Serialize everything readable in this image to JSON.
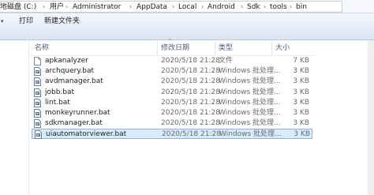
{
  "address": {
    "crumbs": [
      "地磁盘 (C:)",
      "用户",
      "Administrator",
      "AppData",
      "Local",
      "Android",
      "Sdk",
      "tools",
      "bin"
    ],
    "separator": "›"
  },
  "toolbar": {
    "organize_arrow": "▾",
    "print": "打印",
    "new_folder": "新建文件夹"
  },
  "columns": {
    "name": "名称",
    "date": "修改日期",
    "type": "类型",
    "size": "大小"
  },
  "files": [
    {
      "name": "apkanalyzer",
      "date": "2020/5/18 21:28",
      "type": "文件",
      "size": "7 KB",
      "icon": "file-icon"
    },
    {
      "name": "archquery.bat",
      "date": "2020/5/18 21:28",
      "type": "Windows 批处理...",
      "size": "3 KB",
      "icon": "batch-file-icon"
    },
    {
      "name": "avdmanager.bat",
      "date": "2020/5/18 21:28",
      "type": "Windows 批处理...",
      "size": "3 KB",
      "icon": "batch-file-icon"
    },
    {
      "name": "jobb.bat",
      "date": "2020/5/18 21:28",
      "type": "Windows 批处理...",
      "size": "3 KB",
      "icon": "batch-file-icon"
    },
    {
      "name": "lint.bat",
      "date": "2020/5/18 21:28",
      "type": "Windows 批处理...",
      "size": "3 KB",
      "icon": "batch-file-icon"
    },
    {
      "name": "monkeyrunner.bat",
      "date": "2020/5/18 21:28",
      "type": "Windows 批处理...",
      "size": "3 KB",
      "icon": "batch-file-icon"
    },
    {
      "name": "sdkmanager.bat",
      "date": "2020/5/18 21:28",
      "type": "Windows 批处理...",
      "size": "3 KB",
      "icon": "batch-file-icon"
    },
    {
      "name": "uiautomatorviewer.bat",
      "date": "2020/5/18 21:28",
      "type": "Windows 批处理...",
      "size": "3 KB",
      "icon": "batch-file-icon",
      "selected": true
    }
  ],
  "colors": {
    "selection_bg": "#d9ebfc",
    "selection_border": "#86b6e8",
    "toolbar_gradient_top": "#f4f8fd",
    "header_text": "#4c607a"
  }
}
